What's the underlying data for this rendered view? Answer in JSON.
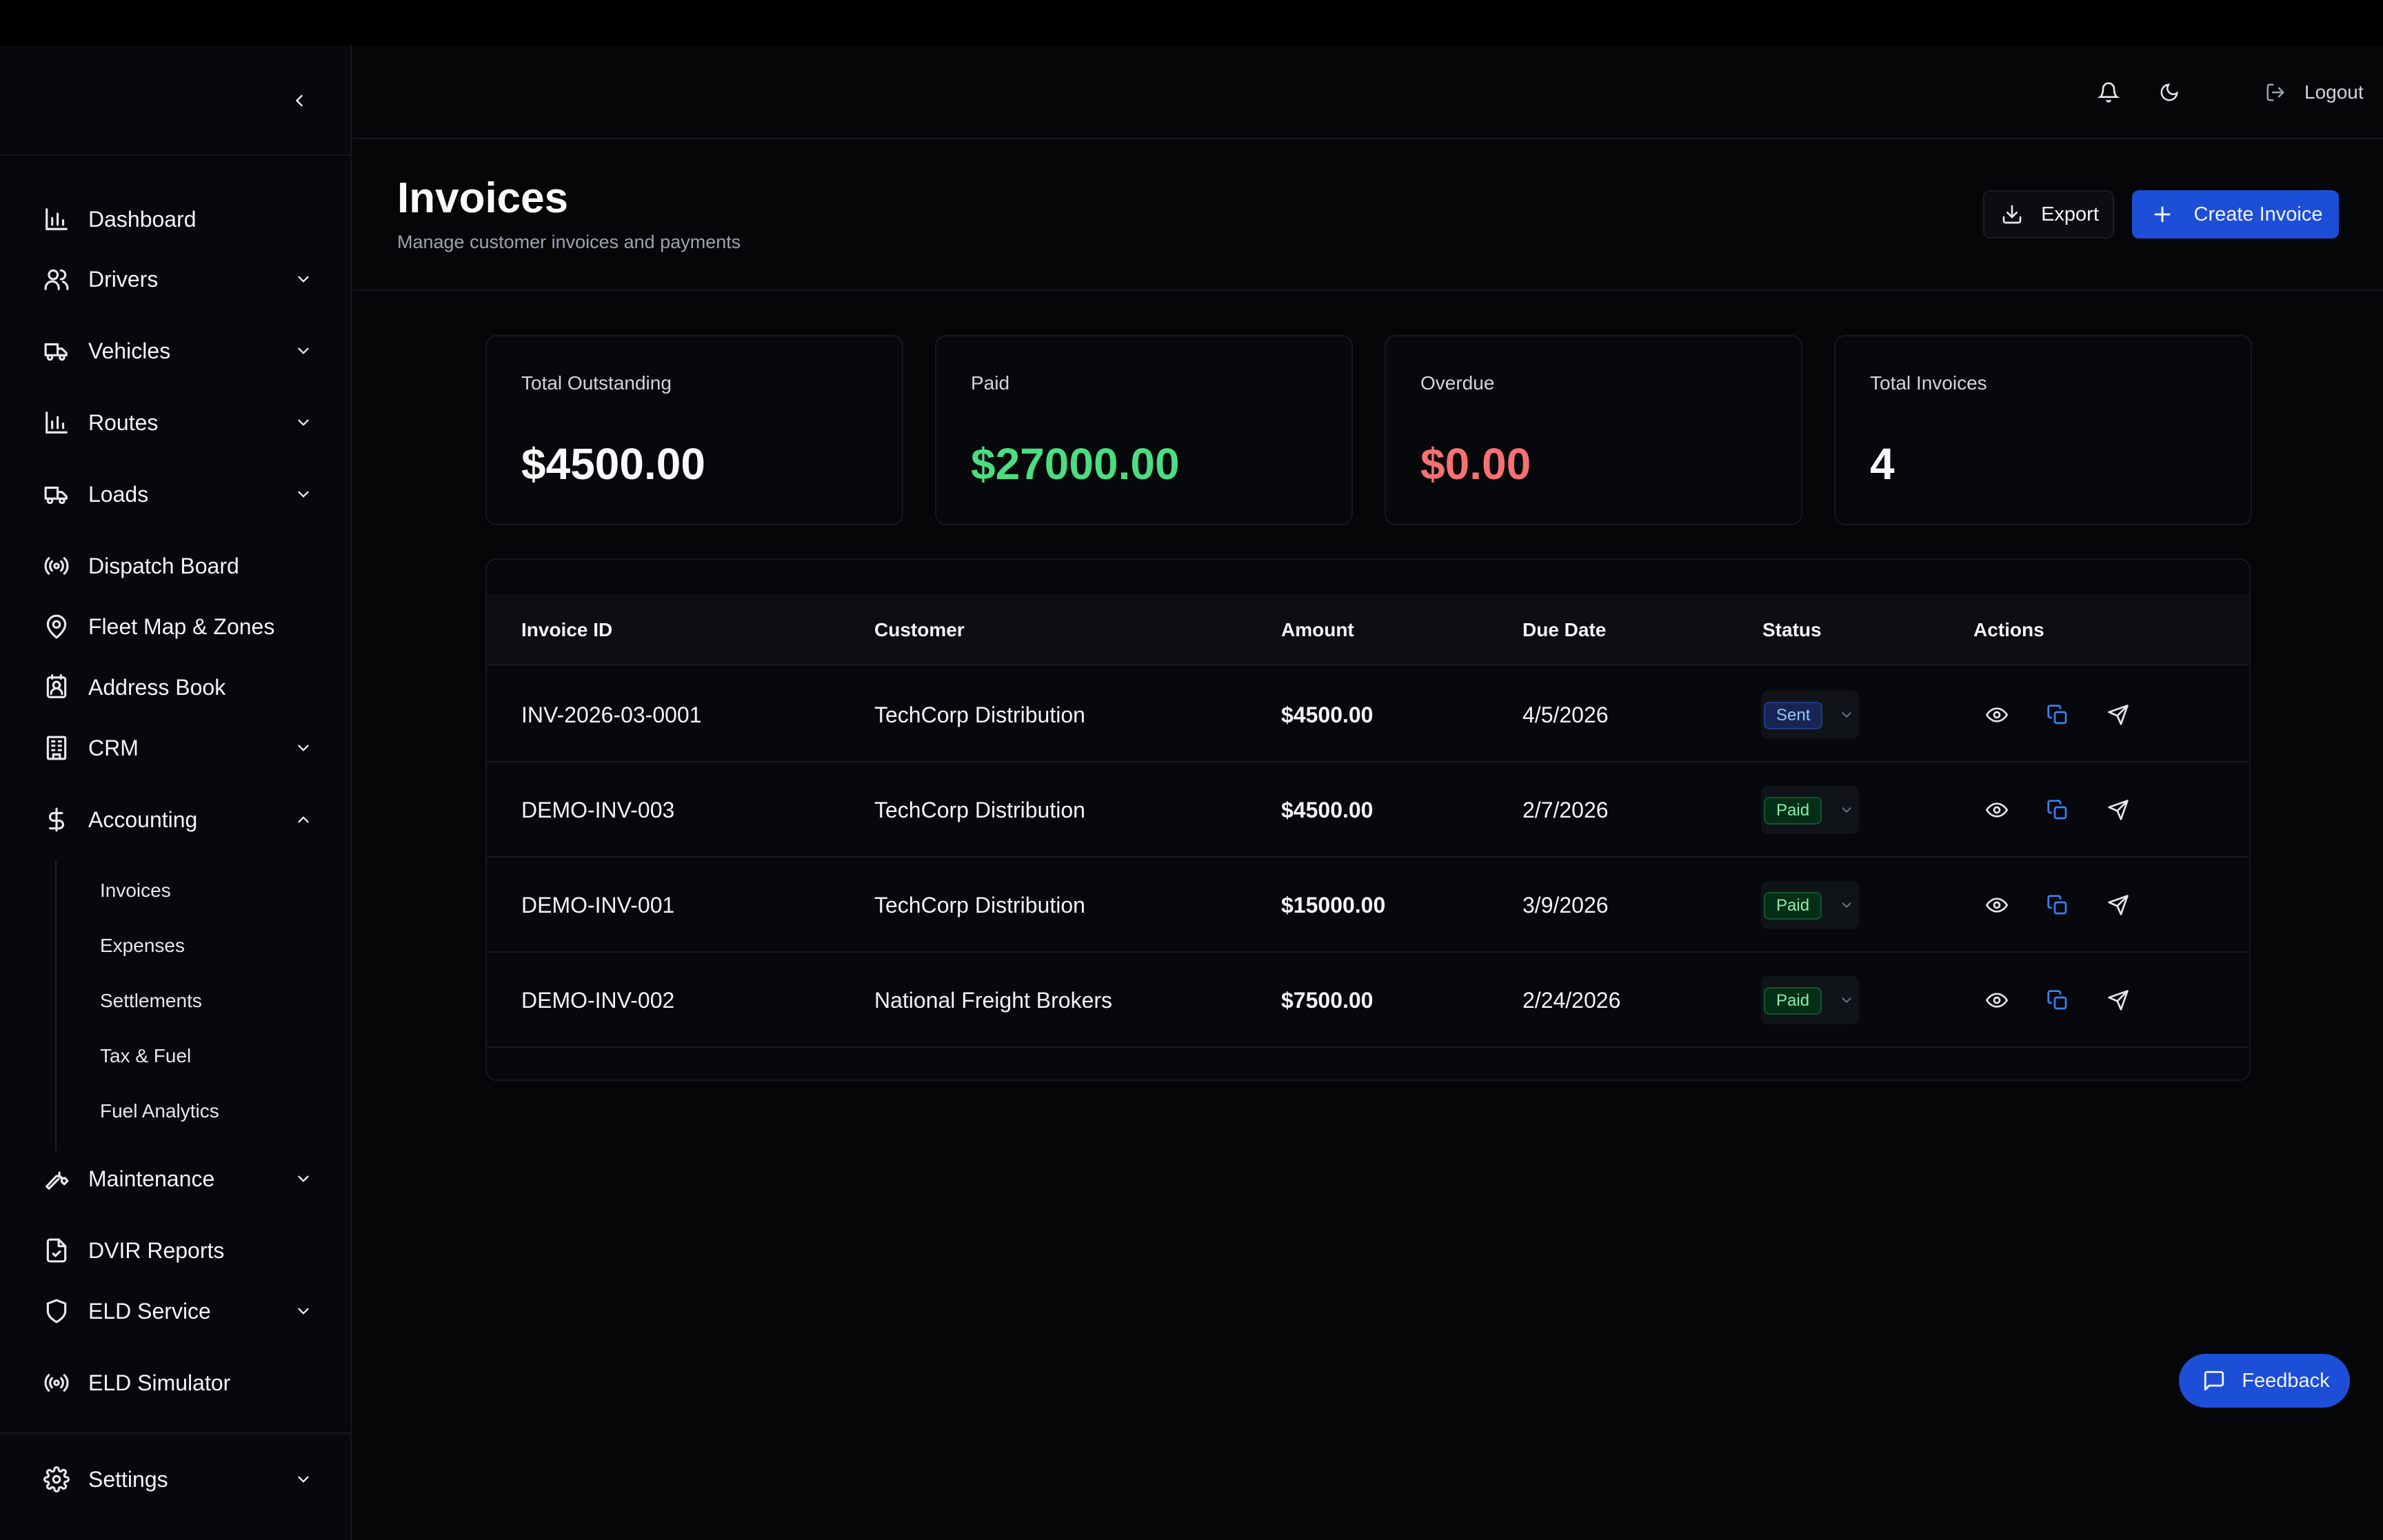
{
  "header": {
    "logout_label": "Logout"
  },
  "page": {
    "title": "Invoices",
    "subtitle": "Manage customer invoices and payments",
    "export_label": "Export",
    "create_label": "Create Invoice"
  },
  "sidebar": {
    "items": [
      {
        "label": "Dashboard",
        "icon": "bar-chart-icon"
      },
      {
        "label": "Drivers",
        "icon": "users-icon"
      },
      {
        "label": "Vehicles",
        "icon": "truck-icon"
      },
      {
        "label": "Routes",
        "icon": "bar-chart-icon"
      },
      {
        "label": "Loads",
        "icon": "truck-icon"
      },
      {
        "label": "Dispatch Board",
        "icon": "radio-icon"
      },
      {
        "label": "Fleet Map & Zones",
        "icon": "map-pin-icon"
      },
      {
        "label": "Address Book",
        "icon": "contact-icon"
      },
      {
        "label": "CRM",
        "icon": "building-icon"
      },
      {
        "label": "Accounting",
        "icon": "dollar-icon"
      },
      {
        "label": "Maintenance",
        "icon": "wrench-icon"
      },
      {
        "label": "DVIR Reports",
        "icon": "file-check-icon"
      },
      {
        "label": "ELD Service",
        "icon": "shield-icon"
      },
      {
        "label": "ELD Simulator",
        "icon": "radio-icon"
      },
      {
        "label": "Settings",
        "icon": "gear-icon"
      }
    ],
    "accounting_sub": [
      "Invoices",
      "Expenses",
      "Settlements",
      "Tax & Fuel",
      "Fuel Analytics"
    ]
  },
  "stats": [
    {
      "label": "Total Outstanding",
      "value": "$4500.00",
      "color": "#f9fafb"
    },
    {
      "label": "Paid",
      "value": "$27000.00",
      "color": "#4ade80"
    },
    {
      "label": "Overdue",
      "value": "$0.00",
      "color": "#f87171"
    },
    {
      "label": "Total Invoices",
      "value": "4",
      "color": "#f9fafb"
    }
  ],
  "table": {
    "columns": [
      "Invoice ID",
      "Customer",
      "Amount",
      "Due Date",
      "Status",
      "Actions"
    ],
    "rows": [
      {
        "id": "INV-2026-03-0001",
        "customer": "TechCorp Distribution",
        "amount": "$4500.00",
        "due": "4/5/2026",
        "status": "Sent"
      },
      {
        "id": "DEMO-INV-003",
        "customer": "TechCorp Distribution",
        "amount": "$4500.00",
        "due": "2/7/2026",
        "status": "Paid"
      },
      {
        "id": "DEMO-INV-001",
        "customer": "TechCorp Distribution",
        "amount": "$15000.00",
        "due": "3/9/2026",
        "status": "Paid"
      },
      {
        "id": "DEMO-INV-002",
        "customer": "National Freight Brokers",
        "amount": "$7500.00",
        "due": "2/24/2026",
        "status": "Paid"
      }
    ]
  },
  "feedback_label": "Feedback",
  "colors": {
    "accent": "#1d4ed8",
    "paid": "#4ade80",
    "overdue": "#f87171"
  }
}
